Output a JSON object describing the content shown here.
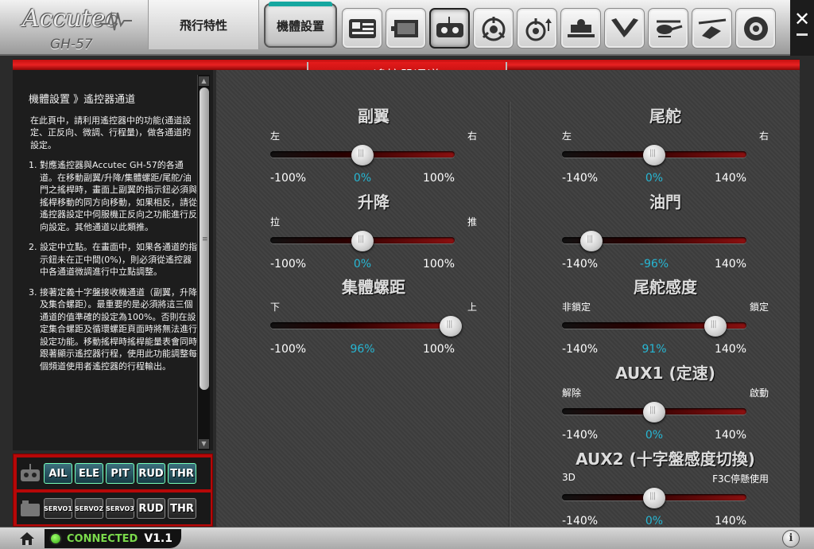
{
  "app": {
    "brand": "Accutec",
    "model": "GH-57"
  },
  "top_tabs": [
    {
      "label": "飛行特性"
    },
    {
      "label": "機體設置"
    }
  ],
  "toolbar_icons": [
    "swashplate-icon",
    "servo-icon",
    "transmitter-icon",
    "gyro-icon",
    "gyro-gain-icon",
    "tail-servo-icon",
    "blade-icon",
    "helicopter-icon",
    "flybar-icon",
    "disc-icon"
  ],
  "section_title": "遙控器通道",
  "sidebar": {
    "heading": "機體設置 》遙控器通道",
    "intro": "在此頁中，請利用遙控器中的功能(通道設定、正反向、微調、行程量)，做各通道的設定。",
    "steps": [
      {
        "n": "1.",
        "text": "對應遙控器與Accutec GH-57的各通道。在移動副翼/升降/集體螺距/尾舵/油門之搖桿時，畫面上副翼的指示鈕必須與搖桿移動的同方向移動，如果相反，請從遙控器設定中伺服機正反向之功能進行反向設定。其他通道以此類推。"
      },
      {
        "n": "2.",
        "text": "設定中立點。在畫面中，如果各通道的指示鈕未在正中間(0%)，則必須從遙控器中各通道微調進行中立點調整。"
      },
      {
        "n": "3.",
        "text": "接著定義十字盤接收機通道（副翼，升降及集合螺距）。最重要的是必須將這三個通道的值準確的設定為100%。否則在設定集合螺距及循環螺距頁面時將無法進行設定功能。移動搖桿時搖桿能量表會同時跟著顯示遙控器行程，使用此功能調整每個頻道使用者遙控器的行程輸出。"
      }
    ]
  },
  "channels_row1": [
    "AIL",
    "ELE",
    "PIT",
    "RUD",
    "THR"
  ],
  "channels_row2": [
    {
      "l1": "SERVO",
      "l2": "1"
    },
    {
      "l1": "SERVO",
      "l2": "2"
    },
    {
      "l1": "SERVO",
      "l2": "3"
    },
    {
      "l1": "RUD",
      "l2": ""
    },
    {
      "l1": "THR",
      "l2": ""
    }
  ],
  "sliders": {
    "aileron": {
      "title": "副翼",
      "left": "左",
      "right": "右",
      "min": "-100%",
      "max": "100%",
      "value": "0%",
      "pos": 0.5
    },
    "elevator": {
      "title": "升降",
      "left": "拉",
      "right": "推",
      "min": "-100%",
      "max": "100%",
      "value": "0%",
      "pos": 0.5
    },
    "pitch": {
      "title": "集體螺距",
      "left": "下",
      "right": "上",
      "min": "-100%",
      "max": "100%",
      "value": "96%",
      "pos": 0.98
    },
    "rudder": {
      "title": "尾舵",
      "left": "左",
      "right": "右",
      "min": "-140%",
      "max": "140%",
      "value": "0%",
      "pos": 0.5
    },
    "throttle": {
      "title": "油門",
      "left": "",
      "right": "",
      "min": "-140%",
      "max": "140%",
      "value": "-96%",
      "pos": 0.16
    },
    "gyro_gain": {
      "title": "尾舵感度",
      "left": "非鎖定",
      "right": "鎖定",
      "min": "-140%",
      "max": "140%",
      "value": "91%",
      "pos": 0.83
    },
    "aux1": {
      "title": "AUX1 (定速)",
      "left": "解除",
      "right": "啟動",
      "min": "-140%",
      "max": "140%",
      "value": "0%",
      "pos": 0.5
    },
    "aux2": {
      "title": "AUX2 (十字盤感度切換)",
      "left": "3D",
      "right": "F3C停懸使用",
      "min": "-140%",
      "max": "140%",
      "value": "0%",
      "pos": 0.5
    }
  },
  "status": {
    "connection": "CONNECTED",
    "version": "V1.1"
  },
  "colors": {
    "accent_red": "#d41414",
    "value_cyan": "#27b7d4",
    "connected_green": "#7ad94b",
    "tab_teal": "#16a7a0"
  }
}
